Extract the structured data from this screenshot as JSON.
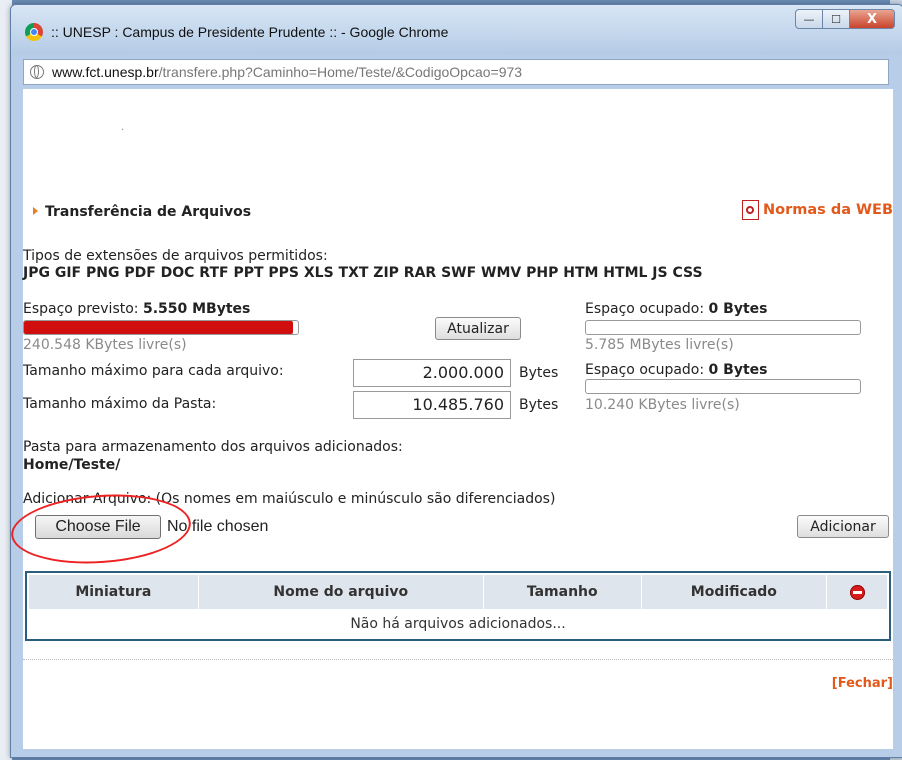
{
  "window": {
    "title": ":: UNESP : Campus de Presidente Prudente :: - Google Chrome",
    "controls": {
      "minimize": "—",
      "maximize": "☐",
      "close": "X"
    }
  },
  "address": {
    "host": "www.fct.unesp.br",
    "path": "/transfere.php?Caminho=Home/Teste/&CodigoOpcao=973"
  },
  "page": {
    "dot": "·",
    "section_title": "Transferência de Arquivos",
    "normas_link": "Normas da WEB",
    "ext_label": "Tipos de extensões de arquivos permitidos:",
    "ext_list": "JPG GIF PNG PDF DOC RTF PPT PPS XLS TXT ZIP RAR SWF WMV PHP HTM HTML JS CSS",
    "espaco_previsto_label": "Espaço previsto:",
    "espaco_previsto_value": "5.550 MBytes",
    "espaco_previsto_fill": 0.98,
    "previsto_livre": "240.548 KBytes livre(s)",
    "atualizar_button": "Atualizar",
    "espaco_ocupado1_label": "Espaço ocupado:",
    "espaco_ocupado1_value": "0 Bytes",
    "ocupado1_fill": 0,
    "ocupado1_livre": "5.785 MBytes livre(s)",
    "tam_arquivo_label": "Tamanho máximo para cada arquivo:",
    "tam_arquivo_value": "2.000.000",
    "bytes_unit": "Bytes",
    "espaco_ocupado2_label": "Espaço ocupado:",
    "espaco_ocupado2_value": "0 Bytes",
    "ocupado2_fill": 0,
    "tam_pasta_label": "Tamanho máximo da Pasta:",
    "tam_pasta_value": "10.485.760",
    "ocupado2_livre": "10.240 KBytes livre(s)",
    "pasta_label": "Pasta para armazenamento dos arquivos adicionados:",
    "pasta_value": "Home/Teste/",
    "adicionar_label": "Adicionar Arquivo: (Os nomes em maiúsculo e minúsculo são diferenciados)",
    "choose_file_button": "Choose File",
    "no_file_text": "No file chosen",
    "adicionar_button": "Adicionar",
    "table_headers": [
      "Miniatura",
      "Nome do arquivo",
      "Tamanho",
      "Modificado"
    ],
    "table_empty": "Não há arquivos adicionados...",
    "fechar_link": "[Fechar]"
  },
  "colors": {
    "accent_orange": "#e2591b",
    "bar_red": "#d00e0e",
    "table_border": "#2a5e7e",
    "annotation_circle": "#ee2222"
  }
}
